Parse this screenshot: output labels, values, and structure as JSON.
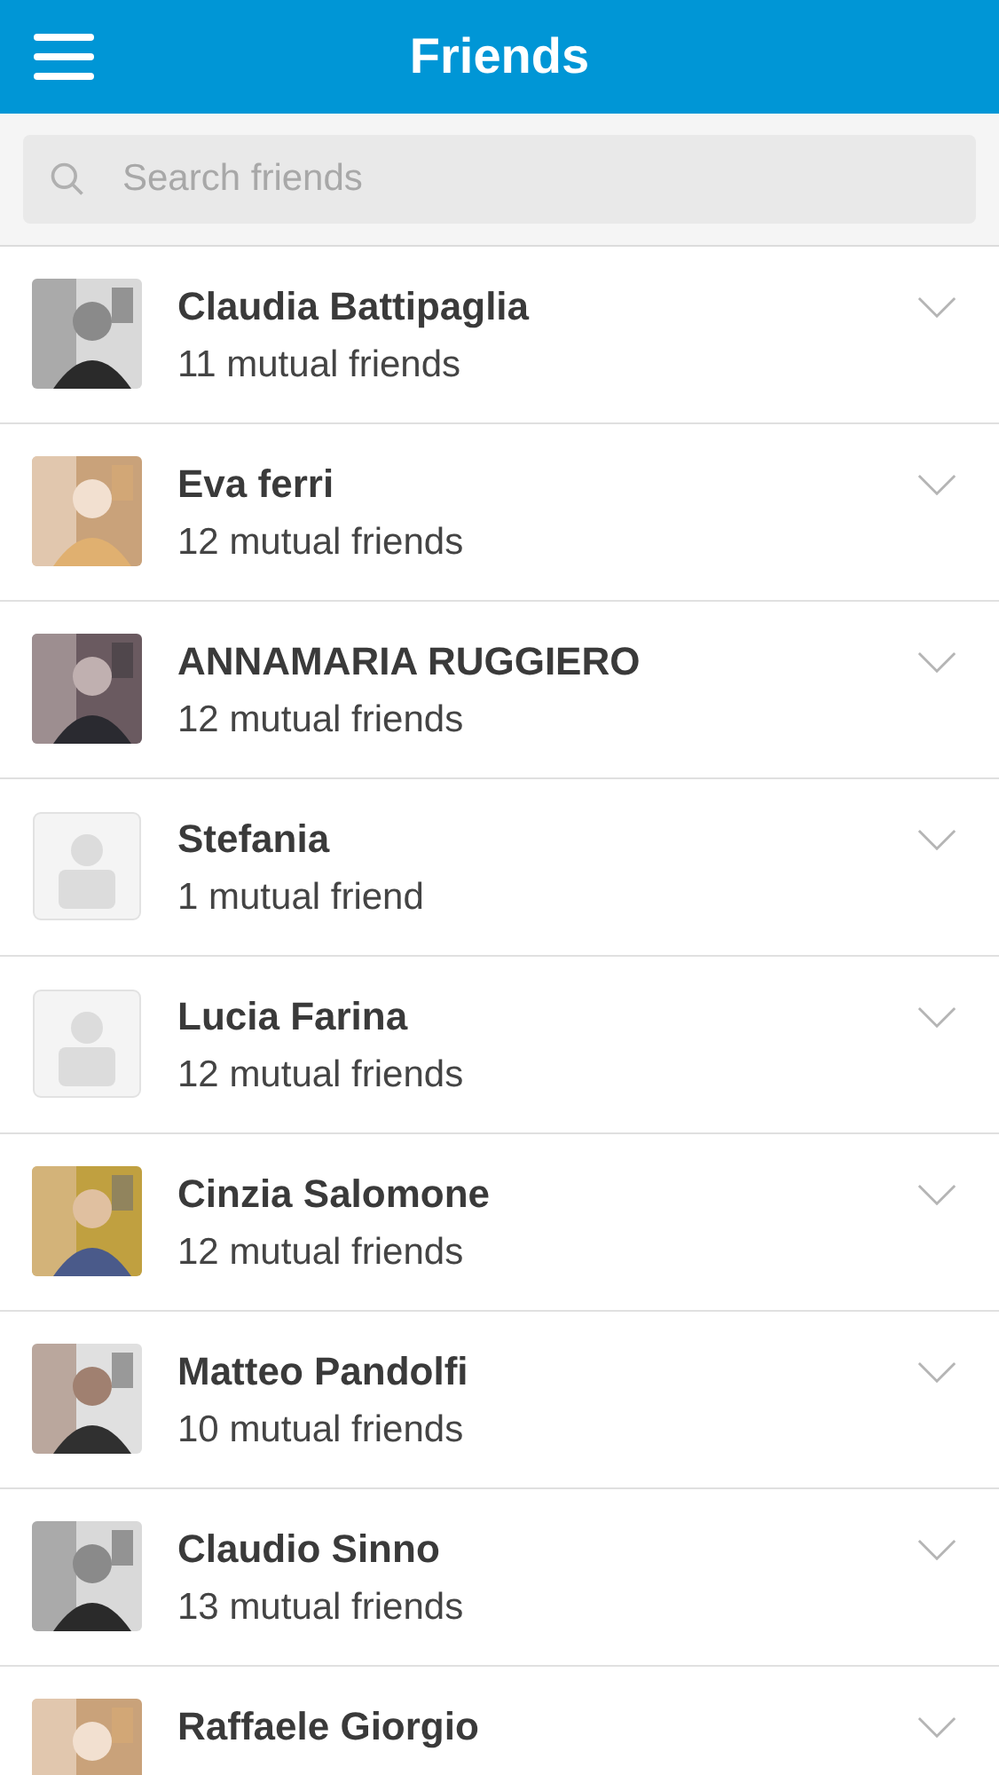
{
  "header": {
    "title": "Friends"
  },
  "search": {
    "placeholder": "Search friends"
  },
  "friends": [
    {
      "name": "Claudia Battipaglia",
      "mutual": "11 mutual friends"
    },
    {
      "name": "Eva ferri",
      "mutual": "12 mutual friends"
    },
    {
      "name": "ANNAMARIA RUGGIERO",
      "mutual": "12 mutual friends"
    },
    {
      "name": "Stefania",
      "mutual": "1 mutual friend",
      "avatar": {
        "kind": "placeholder"
      }
    },
    {
      "name": "Lucia Farina",
      "mutual": "12 mutual friends",
      "avatar": {
        "kind": "placeholder"
      }
    },
    {
      "name": "Cinzia Salomone",
      "mutual": "12 mutual friends"
    },
    {
      "name": "Matteo Pandolfi",
      "mutual": "10 mutual friends"
    },
    {
      "name": "Claudio Sinno",
      "mutual": "13 mutual friends"
    },
    {
      "name": "Raffaele Giorgio"
    }
  ]
}
